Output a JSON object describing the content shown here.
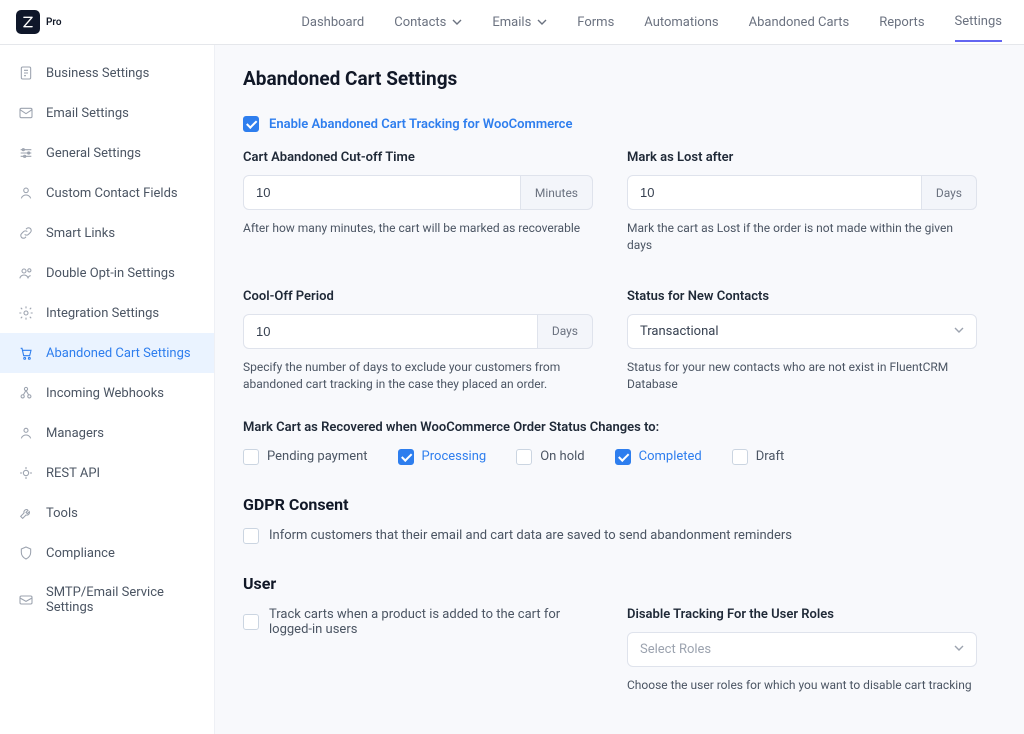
{
  "header": {
    "product_tag": "Pro",
    "nav": {
      "dashboard": "Dashboard",
      "contacts": "Contacts",
      "emails": "Emails",
      "forms": "Forms",
      "automations": "Automations",
      "abandoned_carts": "Abandoned Carts",
      "reports": "Reports",
      "settings": "Settings"
    }
  },
  "sidebar": {
    "business": "Business Settings",
    "email": "Email Settings",
    "general": "General Settings",
    "custom_contact": "Custom Contact Fields",
    "smart_links": "Smart Links",
    "double_optin": "Double Opt-in Settings",
    "integration": "Integration Settings",
    "abandoned": "Abandoned Cart Settings",
    "webhooks": "Incoming Webhooks",
    "managers": "Managers",
    "rest_api": "REST API",
    "tools": "Tools",
    "compliance": "Compliance",
    "smtp": "SMTP/Email Service Settings"
  },
  "page": {
    "title": "Abandoned Cart Settings",
    "enable_label": "Enable Abandoned Cart Tracking for WooCommerce",
    "cutoff": {
      "label": "Cart Abandoned Cut-off Time",
      "value": "10",
      "unit": "Minutes",
      "help": "After how many minutes, the cart will be marked as recoverable"
    },
    "lost": {
      "label": "Mark as Lost after",
      "value": "10",
      "unit": "Days",
      "help": "Mark the cart as Lost if the order is not made within the given days"
    },
    "cooloff": {
      "label": "Cool-Off Period",
      "value": "10",
      "unit": "Days",
      "help": "Specify the number of days to exclude your customers from abandoned cart tracking in the case they placed an order."
    },
    "status_new": {
      "label": "Status for New Contacts",
      "value": "Transactional",
      "help": "Status for your new contacts who are not exist in FluentCRM Database"
    },
    "recovered": {
      "label": "Mark Cart as Recovered when WooCommerce Order Status Changes to:",
      "options": {
        "pending": "Pending payment",
        "processing": "Processing",
        "onhold": "On hold",
        "completed": "Completed",
        "draft": "Draft"
      }
    },
    "gdpr": {
      "heading": "GDPR Consent",
      "inform": "Inform customers that their email and cart data are saved to send abandonment reminders"
    },
    "user": {
      "heading": "User",
      "track_logged": "Track carts when a product is added to the cart for logged-in users",
      "disable_roles_label": "Disable Tracking For the User Roles",
      "disable_roles_placeholder": "Select Roles",
      "disable_roles_help": "Choose the user roles for which you want to disable cart tracking"
    }
  }
}
